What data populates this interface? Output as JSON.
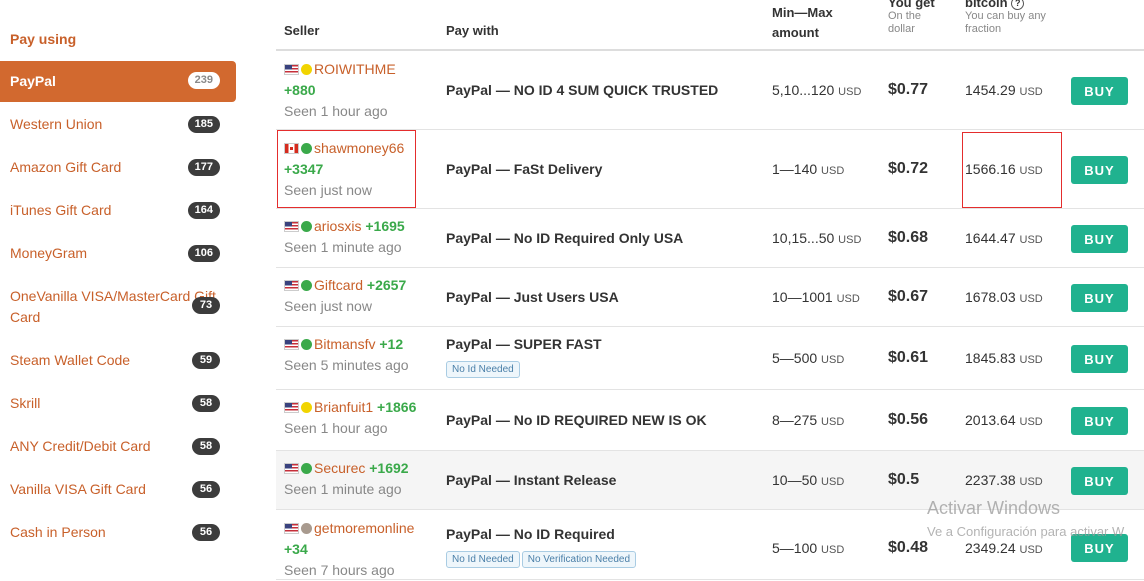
{
  "sidebar": {
    "heading": "Pay using",
    "items": [
      {
        "label": "PayPal",
        "count": "239",
        "active": true
      },
      {
        "label": "Western Union",
        "count": "185"
      },
      {
        "label": "Amazon Gift Card",
        "count": "177"
      },
      {
        "label": "iTunes Gift Card",
        "count": "164"
      },
      {
        "label": "MoneyGram",
        "count": "106"
      },
      {
        "label": "OneVanilla VISA/MasterCard Gift Card",
        "count": "73"
      },
      {
        "label": "Steam Wallet Code",
        "count": "59"
      },
      {
        "label": "Skrill",
        "count": "58"
      },
      {
        "label": "ANY Credit/Debit Card",
        "count": "58"
      },
      {
        "label": "Vanilla VISA Gift Card",
        "count": "56"
      },
      {
        "label": "Cash in Person",
        "count": "56"
      }
    ]
  },
  "table": {
    "headers": {
      "seller": "Seller",
      "pay_with": "Pay with",
      "amount": "Min—Max amount",
      "you_get": "You get",
      "you_get_sub": "On the dollar",
      "bitcoin": "bitcoin",
      "bitcoin_sub": "You can buy any fraction"
    },
    "unit": "USD",
    "buy_label": "BUY",
    "rows": [
      {
        "flag": "us",
        "dot": "#f1d400",
        "seller": "ROIWITHME",
        "score": "+880",
        "seen": "Seen 1 hour ago",
        "pay_with": "PayPal — NO ID 4 SUM QUICK TRUSTED",
        "tags": [],
        "amount": "5,10...120",
        "price": "$0.77",
        "btc": "1454.29"
      },
      {
        "flag": "ca",
        "dot": "#3aa94a",
        "seller": "shawmoney66",
        "score": "+3347",
        "seen": "Seen just now",
        "pay_with": "PayPal — FaSt Delivery",
        "tags": [],
        "amount": "1—140",
        "price": "$0.72",
        "btc": "1566.16"
      },
      {
        "flag": "us",
        "dot": "#3aa94a",
        "seller": "ariosxis",
        "score": "+1695",
        "seen": "Seen 1 minute ago",
        "pay_with": "PayPal — No ID Required Only USA",
        "tags": [],
        "amount": "10,15...50",
        "price": "$0.68",
        "btc": "1644.47"
      },
      {
        "flag": "us",
        "dot": "#3aa94a",
        "seller": "Giftcard",
        "score": "+2657",
        "seen": "Seen just now",
        "pay_with": "PayPal — Just Users USA",
        "tags": [],
        "amount": "10—1001",
        "price": "$0.67",
        "btc": "1678.03"
      },
      {
        "flag": "us",
        "dot": "#3aa94a",
        "seller": "Bitmansfv",
        "score": "+12",
        "seen": "Seen 5 minutes ago",
        "pay_with": "PayPal — SUPER FAST",
        "tags": [
          "No Id Needed"
        ],
        "amount": "5—500",
        "price": "$0.61",
        "btc": "1845.83"
      },
      {
        "flag": "us",
        "dot": "#f1d400",
        "seller": "Brianfuit1",
        "score": "+1866",
        "seen": "Seen 1 hour ago",
        "pay_with": "PayPal — No ID REQUIRED NEW IS OK",
        "tags": [],
        "amount": "8—275",
        "price": "$0.56",
        "btc": "2013.64"
      },
      {
        "flag": "us",
        "dot": "#3aa94a",
        "seller": "Securec",
        "score": "+1692",
        "seen": "Seen 1 minute ago",
        "pay_with": "PayPal — Instant Release",
        "tags": [],
        "amount": "10—50",
        "price": "$0.5",
        "btc": "2237.38"
      },
      {
        "flag": "us",
        "dot": "#a89a8e",
        "seller": "getmoremonline",
        "score": "+34",
        "seen": "Seen 7 hours ago",
        "pay_with": "PayPal — No ID Required",
        "tags": [
          "No Id Needed",
          "No Verification Needed"
        ],
        "amount": "5—100",
        "price": "$0.48",
        "btc": "2349.24"
      }
    ]
  },
  "watermark": {
    "title": "Activar Windows",
    "subtitle": "Ve a Configuración para activar W"
  }
}
